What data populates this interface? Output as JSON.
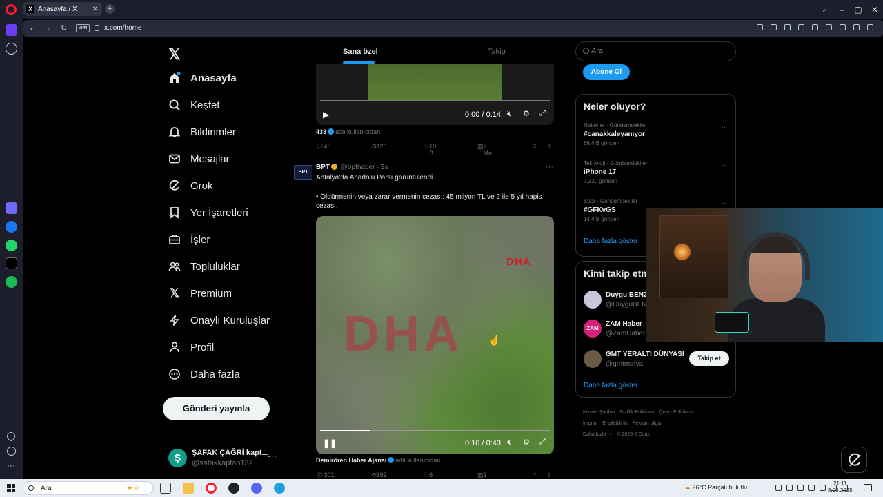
{
  "browser": {
    "tab_title": "Anasayfa / X",
    "vpn_label": "VPN",
    "url": "x.com/home"
  },
  "sidebar": {
    "items": [
      {
        "label": "Anasayfa",
        "icon": "home-icon"
      },
      {
        "label": "Keşfet",
        "icon": "search-icon"
      },
      {
        "label": "Bildirimler",
        "icon": "bell-icon"
      },
      {
        "label": "Mesajlar",
        "icon": "mail-icon"
      },
      {
        "label": "Grok",
        "icon": "grok-icon"
      },
      {
        "label": "Yer İşaretleri",
        "icon": "bookmark-icon"
      },
      {
        "label": "İşler",
        "icon": "briefcase-icon"
      },
      {
        "label": "Topluluklar",
        "icon": "people-icon"
      },
      {
        "label": "Premium",
        "icon": "x-icon"
      },
      {
        "label": "Onaylı Kuruluşlar",
        "icon": "lightning-icon"
      },
      {
        "label": "Profil",
        "icon": "person-icon"
      },
      {
        "label": "Daha fazla",
        "icon": "more-circle-icon"
      }
    ],
    "post_button": "Gönderi yayınla",
    "profile": {
      "avatar_letter": "Ş",
      "name": "ŞAFAK ÇAĞRİ kapt...",
      "handle": "@safakkaptan132"
    }
  },
  "main": {
    "tabs": {
      "for_you": "Sana özel",
      "following": "Takip"
    },
    "tweet1": {
      "video_time": "0:00 / 0:14",
      "source": "433",
      "source_suffix": "adlı kullanıcıdan",
      "replies": "45",
      "retweets": "126",
      "likes": "10 B",
      "views": "2 Mn"
    },
    "tweet2": {
      "avatar_text": "BPT",
      "name": "BPT",
      "handle": "@bpthaber · 3s",
      "text1": "Antalya'da Anadolu Parsı görüntülendi.",
      "text2": "• Öldürmenin veya zarar vermenin cezası: 45 milyon TL ve 2 ile 5 yıl hapis cezası.",
      "video_watermark_small": "DHA",
      "video_watermark_big": "DHA",
      "video_time": "0:10 / 0:43",
      "video_progress": 0.22,
      "source": "Demirören Haber Ajansı",
      "source_suffix": "adlı kullanıcıdan",
      "replies": "301",
      "retweets": "192",
      "likes": "6 B",
      "views": "1 Mn"
    }
  },
  "right": {
    "search_placeholder": "Ara",
    "subscribe": "Abone Ol",
    "trends_title": "Neler oluyor?",
    "trends": [
      {
        "meta": "Haberler · Gündemdekiler",
        "topic": "#canakkaleyanıyor",
        "count": "68,4 B gönderi"
      },
      {
        "meta": "Teknoloji · Gündemdekiler",
        "topic": "iPhone 17",
        "count": "7.230 gönderi"
      },
      {
        "meta": "Spor · Gündemdekiler",
        "topic": "#GFKvGS",
        "count": "14,4 B gönderi"
      }
    ],
    "trends_show_more": "Daha fazla göster",
    "follow_title": "Kimi takip etm",
    "who": [
      {
        "name": "Duygu BENZ",
        "handle": "@DuyguBEN",
        "avatar_color": "#c8c8d8"
      },
      {
        "name": "ZAM Haber",
        "handle": "@ZamHaberA",
        "avatar_color": "#d8217a",
        "avatar_text": "ZAM"
      },
      {
        "name": "GMT YERALTI DÜNYASI",
        "handle": "@gmtmafya",
        "avatar_color": "#6b5a44"
      }
    ],
    "follow_button": "Takip et",
    "follow_show_more": "Daha fazla göster",
    "footer": [
      "Hizmet Şartları",
      "Gizlilik Politikası",
      "Çerez Politikası",
      "Imprint",
      "Erişilebilirlik",
      "Reklam bilgisi",
      "Daha fazla ···",
      "© 2025 X Corp."
    ]
  },
  "taskbar": {
    "search": "Ara",
    "weather_temp": "26°C",
    "weather_text": "Parçalı bulutlu",
    "time": "21:11",
    "date": "8.08.2025"
  },
  "colors": {
    "accent": "#1d9bf0",
    "opera_red": "#ff1b2d"
  }
}
